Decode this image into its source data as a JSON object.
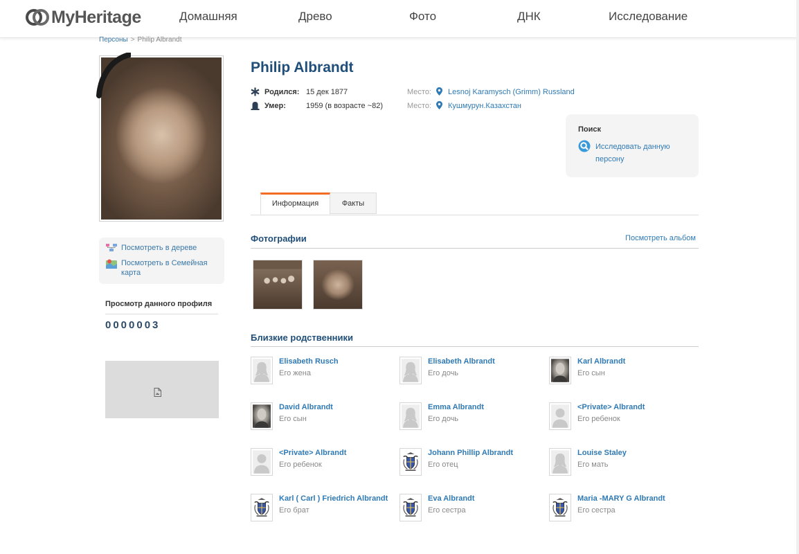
{
  "header": {
    "logo_text": "MyHeritage",
    "nav": [
      "Домашняя",
      "Древо",
      "Фото",
      "ДНК",
      "Исследование"
    ]
  },
  "breadcrumb": {
    "parent": "Персоны",
    "separator": ">",
    "current": "Philip Albrandt"
  },
  "sidebar": {
    "view_in_tree": "Посмотреть в дереве",
    "view_in_family_map": "Посмотреть в Семейная карта",
    "profile_views_title": "Просмотр данного профиля",
    "profile_views_count": "0000003"
  },
  "person": {
    "name": "Philip Albrandt",
    "birth": {
      "label": "Родился:",
      "date": "15 дек 1877",
      "place_label": "Место:",
      "place": "Lesnoj Karamysch (Grimm) Russland"
    },
    "death": {
      "label": "Умер:",
      "date": "1959 (в возрасте ~82)",
      "place_label": "Место:",
      "place": "Кушмурун.Казахстан"
    }
  },
  "search": {
    "title": "Поиск",
    "link": "Исследовать данную персону"
  },
  "tabs": {
    "info": "Информация",
    "facts": "Факты"
  },
  "photos": {
    "title": "Фотографии",
    "view_album": "Посмотреть альбом"
  },
  "relatives": {
    "title": "Близкие родственники",
    "items": [
      {
        "name": "Elisabeth Rusch",
        "role": "Его жена",
        "avatar": "female-silhouette-icon"
      },
      {
        "name": "Elisabeth Albrandt",
        "role": "Его дочь",
        "avatar": "female-silhouette-icon"
      },
      {
        "name": "Karl Albrandt",
        "role": "Его сын",
        "avatar": "photo"
      },
      {
        "name": "David Albrandt",
        "role": "Его сын",
        "avatar": "photo"
      },
      {
        "name": "Emma Albrandt",
        "role": "Его дочь",
        "avatar": "female-silhouette-icon"
      },
      {
        "name": "<Private> Albrandt",
        "role": "Его ребенок",
        "avatar": "male-silhouette-icon"
      },
      {
        "name": "<Private> Albrandt",
        "role": "Его ребенок",
        "avatar": "male-silhouette-icon"
      },
      {
        "name": "Johann Phillip Albrandt",
        "role": "Его отец",
        "avatar": "coat-of-arms-icon"
      },
      {
        "name": "Louise Staley",
        "role": "Его мать",
        "avatar": "female-silhouette-icon"
      },
      {
        "name": "Karl ( Carl ) Friedrich Albrandt",
        "role": "Его брат",
        "avatar": "coat-of-arms-icon"
      },
      {
        "name": "Eva Albrandt",
        "role": "Его сестра",
        "avatar": "coat-of-arms-icon"
      },
      {
        "name": "Maria -MARY G Albrandt",
        "role": "Его сестра",
        "avatar": "coat-of-arms-icon"
      }
    ]
  },
  "colors": {
    "link": "#2f7ab5",
    "heading": "#1f4e79",
    "tab_accent": "#f26d23"
  }
}
